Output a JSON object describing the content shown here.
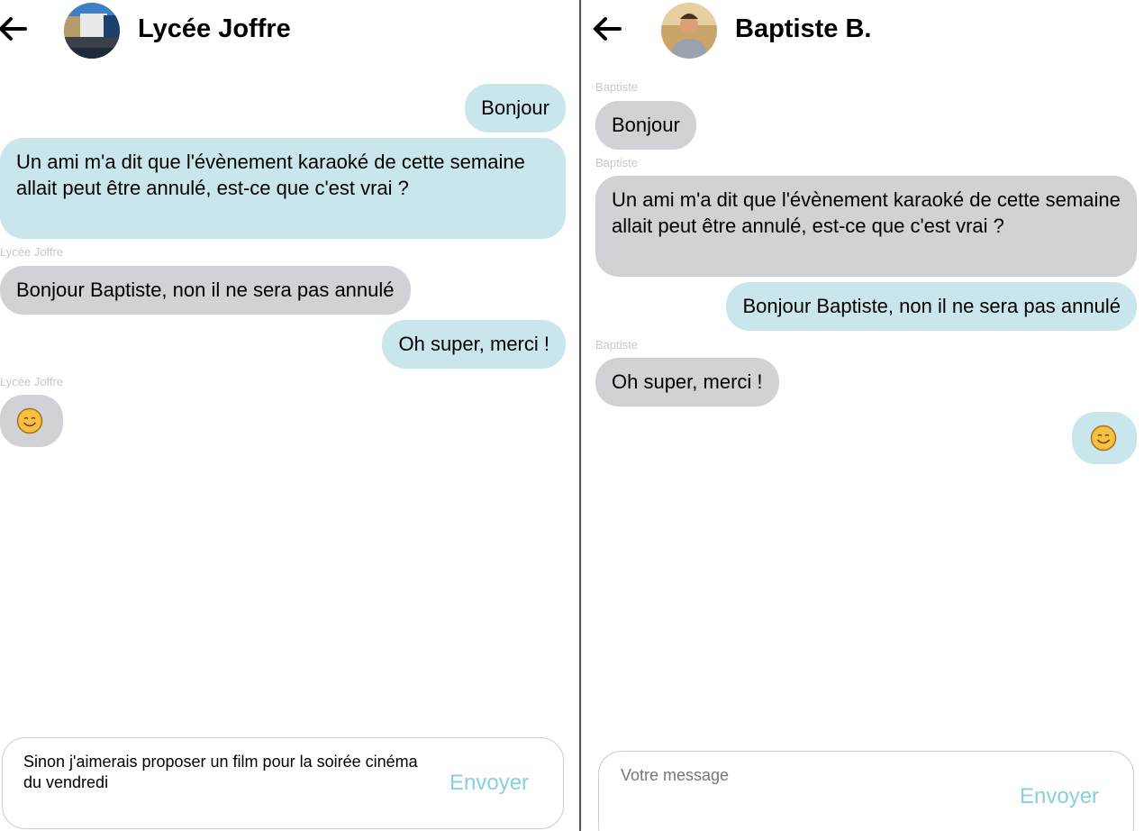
{
  "left": {
    "title": "Lycée Joffre",
    "messages": [
      {
        "text": "Bonjour",
        "from": "me"
      },
      {
        "text": "Un ami m'a dit que l'évènement karaoké de cette semaine allait peut être annulé, est-ce que c'est vrai ?",
        "from": "me"
      },
      {
        "sender": "Lycée Joffre",
        "text": "Bonjour Baptiste, non il ne sera pas annulé",
        "from": "other"
      },
      {
        "text": "Oh super, merci !",
        "from": "me"
      },
      {
        "sender": "Lycée Joffre",
        "emoji": "smiling-face",
        "from": "other"
      }
    ],
    "input_value": "Sinon j'aimerais proposer un film pour la soirée cinéma du vendredi",
    "send_label": "Envoyer"
  },
  "right": {
    "title": "Baptiste B.",
    "messages": [
      {
        "sender": "Baptiste",
        "text": "Bonjour",
        "from": "other"
      },
      {
        "sender": "Baptiste",
        "text": "Un ami m'a dit que l'évènement karaoké de cette semaine allait peut être annulé, est-ce que c'est vrai ?",
        "from": "other"
      },
      {
        "text": "Bonjour Baptiste, non il ne sera pas annulé",
        "from": "me"
      },
      {
        "sender": "Baptiste",
        "text": "Oh super, merci !",
        "from": "other"
      },
      {
        "emoji": "smiling-face",
        "from": "me"
      }
    ],
    "input_placeholder": "Votre message",
    "send_label": "Envoyer"
  },
  "colors": {
    "sent": "#c9e6ed",
    "received": "#d1d1d6",
    "send_button": "#86d0e0"
  }
}
